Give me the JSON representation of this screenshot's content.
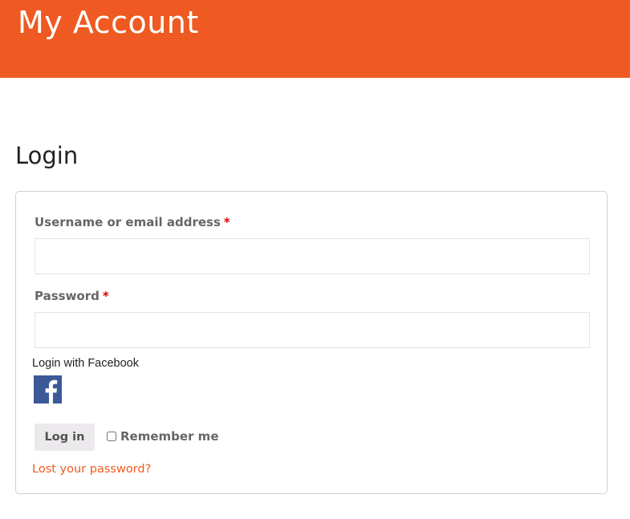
{
  "colors": {
    "accent": "#ee5a21",
    "facebook": "#3b5998",
    "required": "#dd0000"
  },
  "header": {
    "title": "My Account"
  },
  "login": {
    "title": "Login",
    "username_label": "Username or email address",
    "password_label": "Password",
    "required_mark": "*",
    "username_value": "",
    "password_value": "",
    "facebook_label": "Login with Facebook",
    "facebook_icon": "facebook-f-icon",
    "login_button": "Log in",
    "remember_label": "Remember me",
    "remember_checked": false,
    "lost_password": "Lost your password?"
  }
}
